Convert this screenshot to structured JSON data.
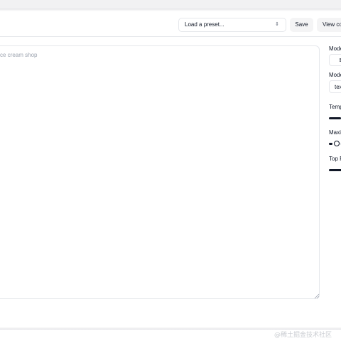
{
  "toolbar": {
    "preset_placeholder": "Load a preset...",
    "preset_chevron": "⇕",
    "save_label": "Save",
    "view_code_label": "View co"
  },
  "editor": {
    "placeholder": "ce cream shop"
  },
  "sidebar": {
    "mode_label": "Mode",
    "mode_icon": "≣",
    "model_label": "Mode",
    "model_value": "tex",
    "temperature_label": "Temp",
    "temperature_level": 0.55,
    "max_length_label": "Maxi",
    "max_length_level": 0.15,
    "top_p_label": "Top P",
    "top_p_level": 1.0
  },
  "watermark": "@稀土掘金技术社区"
}
